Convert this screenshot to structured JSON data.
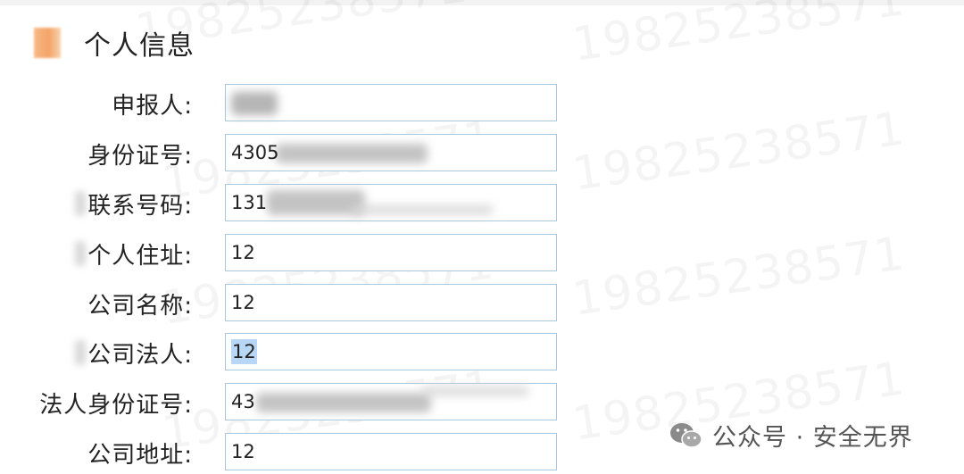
{
  "watermark": "19825238571",
  "section": {
    "title": "个人信息"
  },
  "fields": [
    {
      "label": "申报人:",
      "value": ""
    },
    {
      "label": "身份证号:",
      "value": "4305"
    },
    {
      "label": "联系号码:",
      "value": "131"
    },
    {
      "label": "个人住址:",
      "value": "12"
    },
    {
      "label": "公司名称:",
      "value": "12"
    },
    {
      "label": "公司法人:",
      "value": "12"
    },
    {
      "label": "法人身份证号:",
      "value": "43"
    },
    {
      "label": "公司地址:",
      "value": "12"
    }
  ],
  "footer": {
    "text": "公众号 · 安全无界"
  },
  "colors": {
    "field_border": "#a7c8de",
    "selection": "#b8d6f5",
    "accent": "#f39a58"
  }
}
